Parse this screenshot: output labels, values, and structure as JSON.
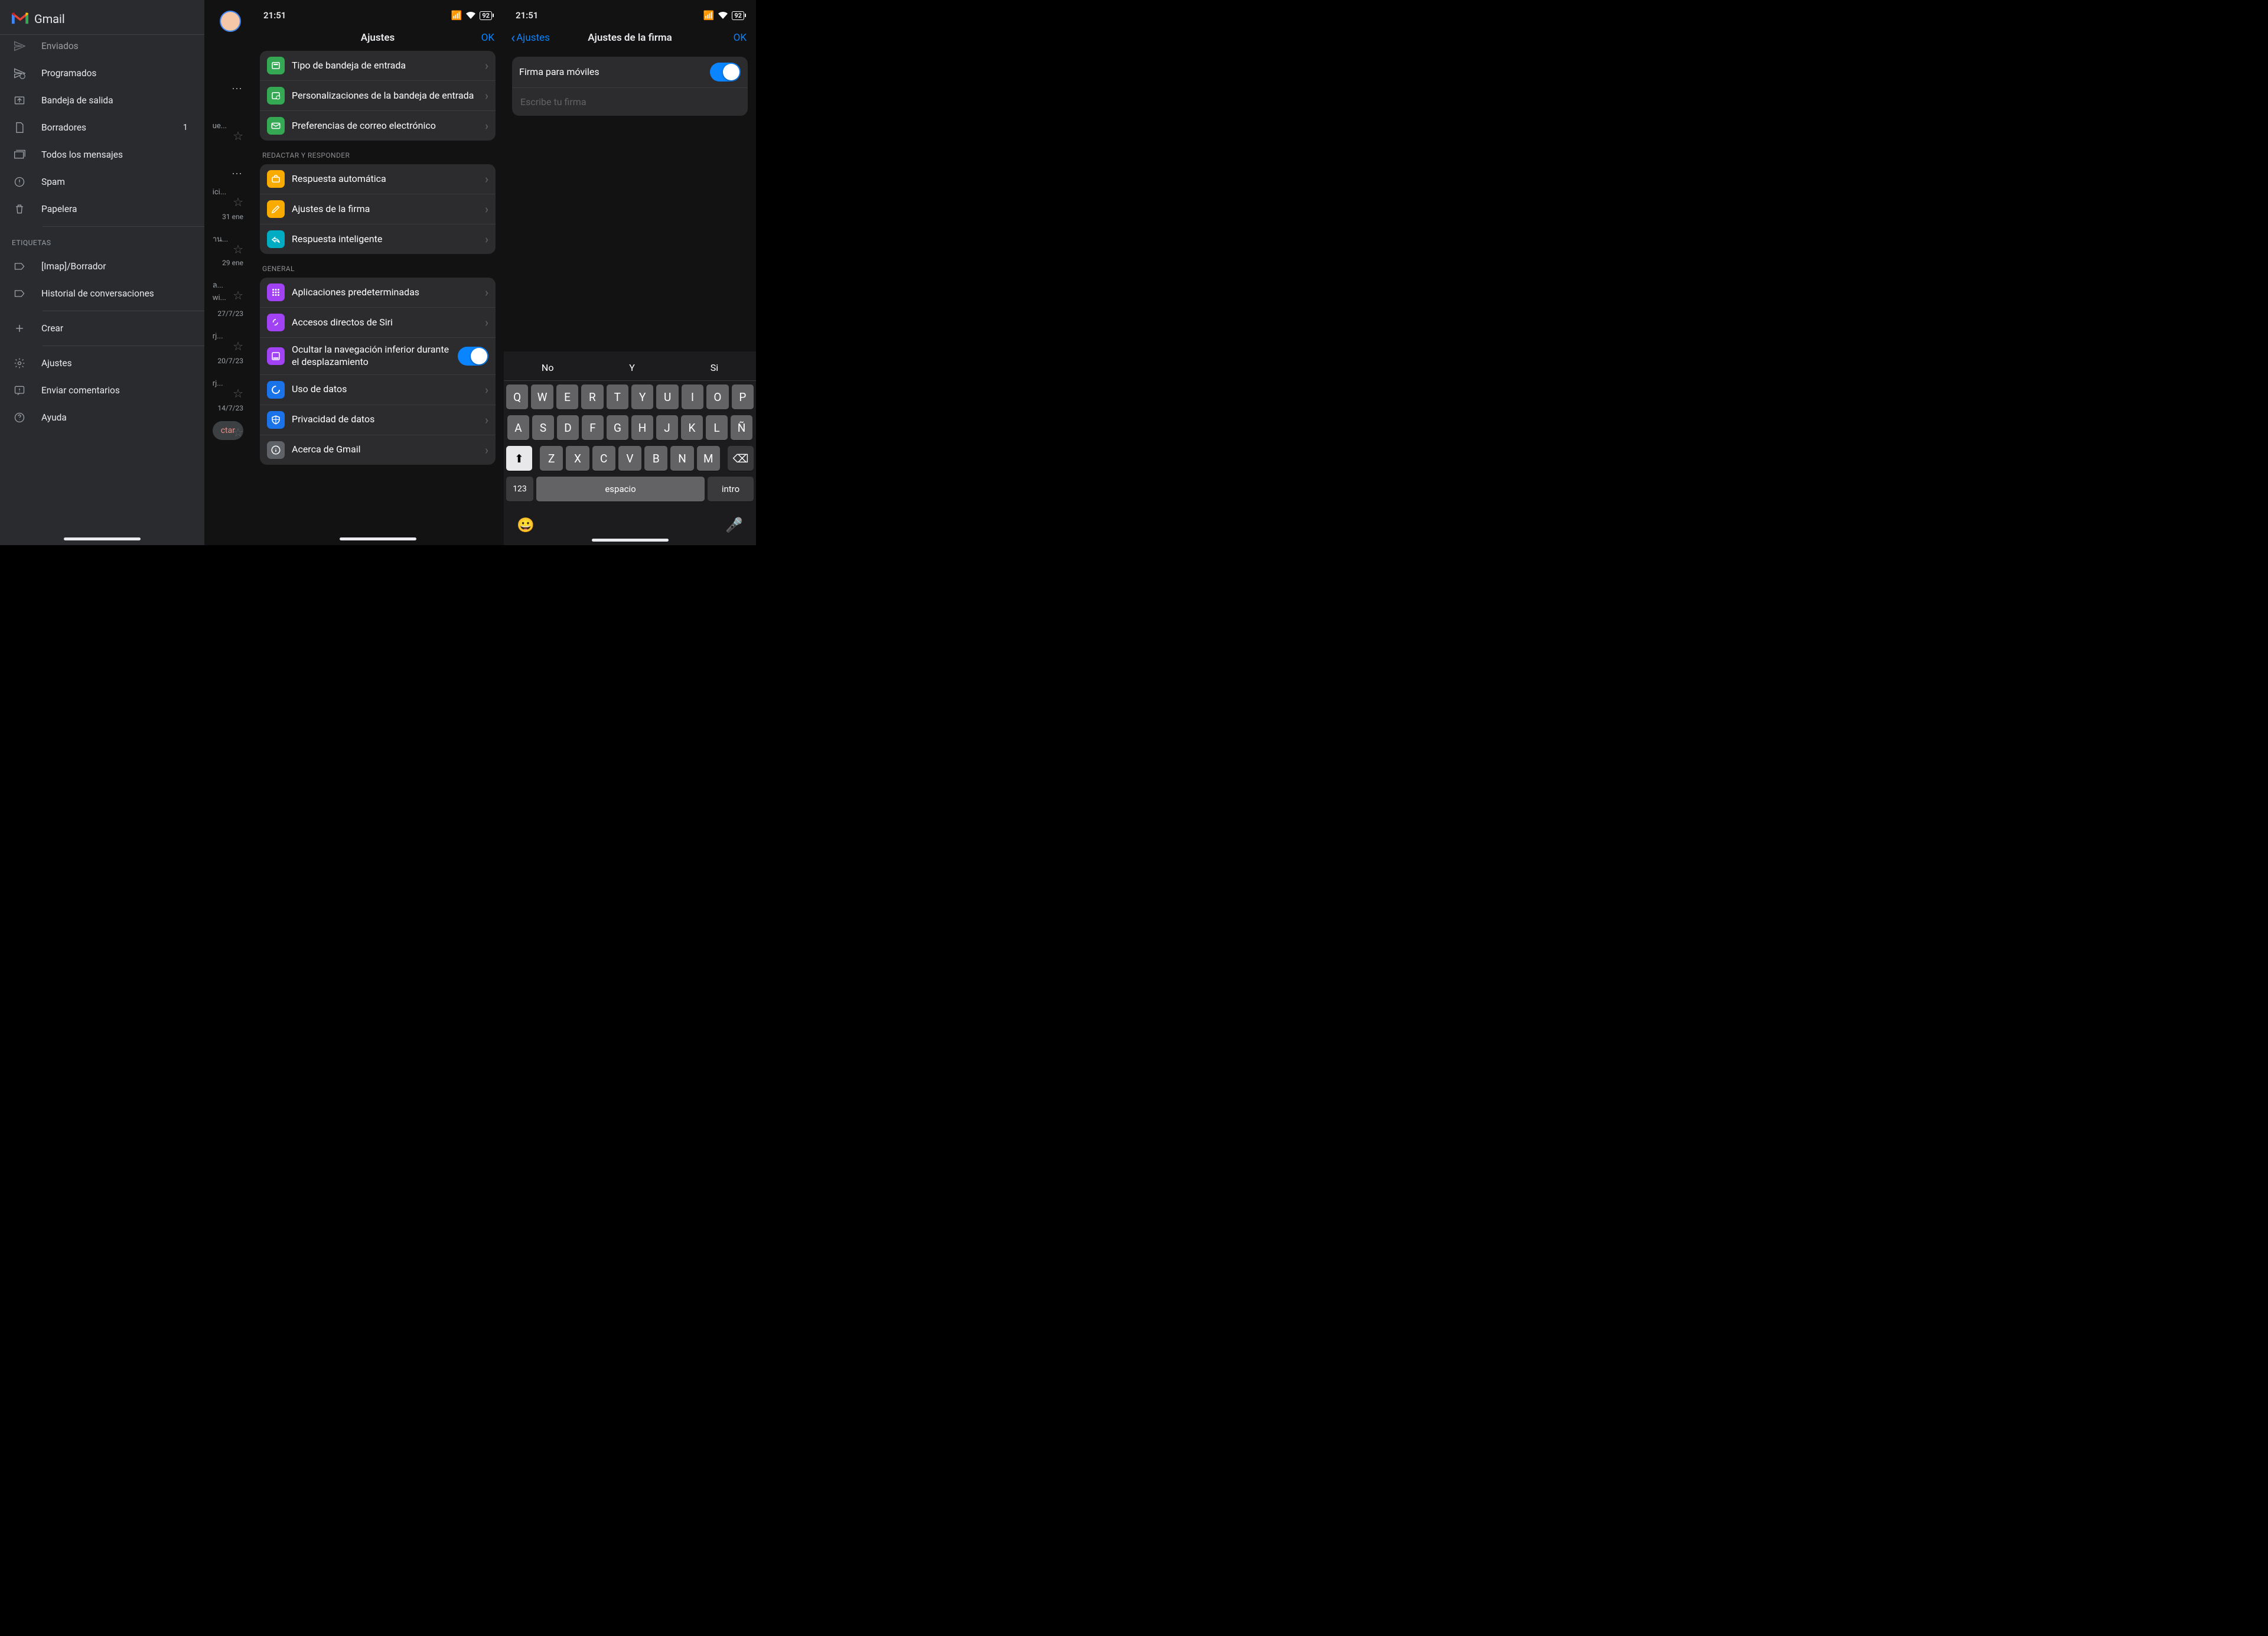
{
  "panel1": {
    "app_name": "Gmail",
    "drawer": {
      "items": [
        {
          "icon": "send",
          "label": "Enviados",
          "badge": ""
        },
        {
          "icon": "schedule",
          "label": "Programados",
          "badge": ""
        },
        {
          "icon": "outbox",
          "label": "Bandeja de salida",
          "badge": ""
        },
        {
          "icon": "draft",
          "label": "Borradores",
          "badge": "1"
        },
        {
          "icon": "all",
          "label": "Todos los mensajes",
          "badge": ""
        },
        {
          "icon": "spam",
          "label": "Spam",
          "badge": ""
        },
        {
          "icon": "trash",
          "label": "Papelera",
          "badge": ""
        }
      ],
      "section_label": "ETIQUETAS",
      "labels": [
        {
          "icon": "label",
          "label": "[Imap]/Borrador"
        },
        {
          "icon": "label",
          "label": "Historial de conversaciones"
        }
      ],
      "create_label": "Crear",
      "footer": [
        {
          "icon": "gear",
          "label": "Ajustes"
        },
        {
          "icon": "feedback",
          "label": "Enviar comentarios"
        },
        {
          "icon": "help",
          "label": "Ayuda"
        }
      ]
    },
    "inbox_partial": {
      "rows": [
        {
          "snip": "",
          "date": "",
          "star": false,
          "dots": true
        },
        {
          "snip": "ue...",
          "date": "",
          "star": true
        },
        {
          "snip": "",
          "date": "",
          "star": false,
          "dots": true
        },
        {
          "snip": "ici...",
          "date": "",
          "star": true
        },
        {
          "snip": "",
          "date": "31 ene"
        },
        {
          "snip": "าน...",
          "date": "",
          "star": true
        },
        {
          "snip": "",
          "date": "29 ene"
        },
        {
          "snip": "ล...\nwi...",
          "date": "",
          "star": true
        },
        {
          "snip": "",
          "date": "27/7/23"
        },
        {
          "snip": "rj...",
          "date": "",
          "star": true
        },
        {
          "snip": "",
          "date": "20/7/23"
        },
        {
          "snip": "rj...",
          "date": "",
          "star": true
        },
        {
          "snip": "",
          "date": "14/7/23"
        },
        {
          "snip": "ctar",
          "date": "",
          "star": true,
          "compose": true
        }
      ]
    }
  },
  "panel2": {
    "time": "21:51",
    "battery": "92",
    "title": "Ajustes",
    "ok": "OK",
    "group1": [
      {
        "color": "#34a853",
        "icon": "inbox",
        "label": "Tipo de bandeja de entrada"
      },
      {
        "color": "#34a853",
        "icon": "inbox-cfg",
        "label": "Personalizaciones de la bandeja de entrada"
      },
      {
        "color": "#34a853",
        "icon": "mail",
        "label": "Preferencias de correo electrónico"
      }
    ],
    "section_compose": "REDACTAR Y RESPONDER",
    "group2": [
      {
        "color": "#f9ab00",
        "icon": "auto",
        "label": "Respuesta automática"
      },
      {
        "color": "#f9ab00",
        "icon": "pen",
        "label": "Ajustes de la firma"
      },
      {
        "color": "#00acc1",
        "icon": "reply",
        "label": "Respuesta inteligente"
      }
    ],
    "section_general": "GENERAL",
    "group3": [
      {
        "color": "#a142f4",
        "icon": "apps",
        "label": "Aplicaciones predeterminadas"
      },
      {
        "color": "#a142f4",
        "icon": "siri",
        "label": "Accesos directos de Siri"
      },
      {
        "color": "#a142f4",
        "icon": "nav",
        "label": "Ocultar la navegación inferior durante el desplazamiento",
        "toggle": true
      },
      {
        "color": "#1a73e8",
        "icon": "data",
        "label": "Uso de datos"
      },
      {
        "color": "#1a73e8",
        "icon": "shield",
        "label": "Privacidad de datos"
      },
      {
        "color": "#5f6368",
        "icon": "info",
        "label": "Acerca de Gmail"
      }
    ]
  },
  "panel3": {
    "time": "21:51",
    "battery": "92",
    "back": "Ajustes",
    "title": "Ajustes de la firma",
    "ok": "OK",
    "toggle_label": "Firma para móviles",
    "placeholder": "Escribe tu firma",
    "keyboard": {
      "suggestions": [
        "No",
        "Y",
        "Si"
      ],
      "row1": [
        "Q",
        "W",
        "E",
        "R",
        "T",
        "Y",
        "U",
        "I",
        "O",
        "P"
      ],
      "row2": [
        "A",
        "S",
        "D",
        "F",
        "G",
        "H",
        "J",
        "K",
        "L",
        "Ñ"
      ],
      "row3": [
        "Z",
        "X",
        "C",
        "V",
        "B",
        "N",
        "M"
      ],
      "num": "123",
      "space": "espacio",
      "enter": "intro"
    }
  }
}
